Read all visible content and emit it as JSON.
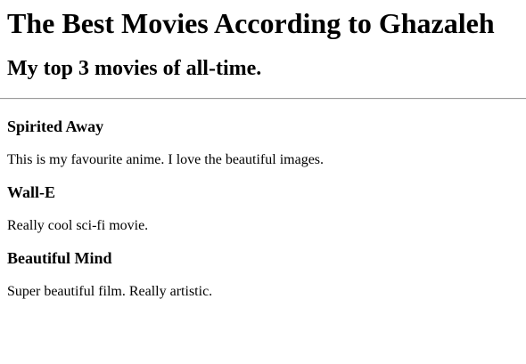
{
  "header": {
    "title": "The Best Movies According to Ghazaleh",
    "subtitle": "My top 3 movies of all-time."
  },
  "movies": [
    {
      "title": "Spirited Away",
      "description": "This is my favourite anime. I love the beautiful images."
    },
    {
      "title": "Wall-E",
      "description": "Really cool sci-fi movie."
    },
    {
      "title": "Beautiful Mind",
      "description": "Super beautiful film. Really artistic."
    }
  ]
}
